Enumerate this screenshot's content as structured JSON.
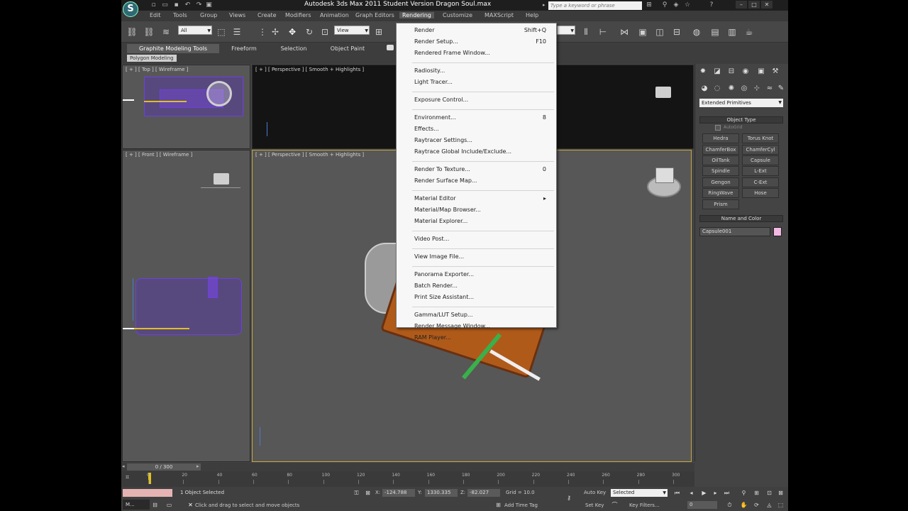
{
  "window": {
    "title": "Autodesk 3ds Max 2011    Student Version    Dragon Soul.max",
    "search_placeholder": "Type a keyword or phrase",
    "app_logo_letter": "S"
  },
  "menubar": [
    "Edit",
    "Tools",
    "Group",
    "Views",
    "Create",
    "Modifiers",
    "Animation",
    "Graph Editors",
    "Rendering",
    "Customize",
    "MAXScript",
    "Help"
  ],
  "toolbar": {
    "selection_filter": "All",
    "reference_coord": "View"
  },
  "ribbon": {
    "tabs": [
      "Graphite Modeling Tools",
      "Freeform",
      "Selection",
      "Object Paint"
    ],
    "active_panel": "Polygon Modeling"
  },
  "viewports": {
    "top": "[ + ] [ Top ] [ Wireframe ]",
    "perspective_small": "[ + ] [ Perspective ] [ Smooth + Highlights ]",
    "front": "[ + ] [ Front ] [ Wireframe ]",
    "perspective_main": "[ + ] [ Perspective ] [ Smooth + Highlights ]"
  },
  "render_menu": [
    {
      "label": "Render",
      "shortcut": "Shift+Q"
    },
    {
      "label": "Render Setup...",
      "shortcut": "F10"
    },
    {
      "label": "Rendered Frame Window...",
      "shortcut": ""
    },
    {
      "sep": true
    },
    {
      "label": "Radiosity...",
      "shortcut": ""
    },
    {
      "label": "Light Tracer...",
      "shortcut": ""
    },
    {
      "sep": true
    },
    {
      "label": "Exposure Control...",
      "shortcut": ""
    },
    {
      "sep": true
    },
    {
      "label": "Environment...",
      "shortcut": "8"
    },
    {
      "label": "Effects...",
      "shortcut": ""
    },
    {
      "label": "Raytracer Settings...",
      "shortcut": ""
    },
    {
      "label": "Raytrace Global Include/Exclude...",
      "shortcut": ""
    },
    {
      "sep": true
    },
    {
      "label": "Render To Texture...",
      "shortcut": "0"
    },
    {
      "label": "Render Surface Map...",
      "shortcut": ""
    },
    {
      "sep": true
    },
    {
      "label": "Material Editor",
      "shortcut": "▸"
    },
    {
      "label": "Material/Map Browser...",
      "shortcut": ""
    },
    {
      "label": "Material Explorer...",
      "shortcut": ""
    },
    {
      "sep": true
    },
    {
      "label": "Video Post...",
      "shortcut": ""
    },
    {
      "sep": true
    },
    {
      "label": "View Image File...",
      "shortcut": ""
    },
    {
      "sep": true
    },
    {
      "label": "Panorama Exporter...",
      "shortcut": ""
    },
    {
      "label": "Batch Render...",
      "shortcut": ""
    },
    {
      "label": "Print Size Assistant...",
      "shortcut": ""
    },
    {
      "sep": true
    },
    {
      "label": "Gamma/LUT Setup...",
      "shortcut": ""
    },
    {
      "label": "Render Message Window...",
      "shortcut": ""
    },
    {
      "label": "RAM Player...",
      "shortcut": ""
    }
  ],
  "command_panel": {
    "category": "Extended Primitives",
    "object_type_title": "Object Type",
    "autogrid": "AutoGrid",
    "buttons": [
      "Hedra",
      "Torus Knot",
      "ChamferBox",
      "ChamferCyl",
      "OilTank",
      "Capsule",
      "Spindle",
      "L-Ext",
      "Gengon",
      "C-Ext",
      "RingWave",
      "Hose",
      "Prism"
    ],
    "name_color_title": "Name and Color",
    "object_name": "Capsule001",
    "object_color": "#f4b8e4"
  },
  "timeline": {
    "frame": "0 / 300",
    "ticks": [
      "0",
      "20",
      "40",
      "60",
      "80",
      "100",
      "120",
      "140",
      "160",
      "180",
      "200",
      "220",
      "240",
      "260",
      "280",
      "300"
    ]
  },
  "status": {
    "selected": "1 Object Selected",
    "prompt": "Click and drag to select and move objects",
    "x": "-124.788",
    "y": "1330.335",
    "z": "-82.027",
    "grid": "Grid = 10.0",
    "autokey": "Auto Key",
    "setkey": "Set Key",
    "key_mode": "Selected",
    "key_filters": "Key Filters...",
    "add_time_tag": "Add Time Tag",
    "current_frame": "0",
    "taskbar_app": "M..."
  }
}
